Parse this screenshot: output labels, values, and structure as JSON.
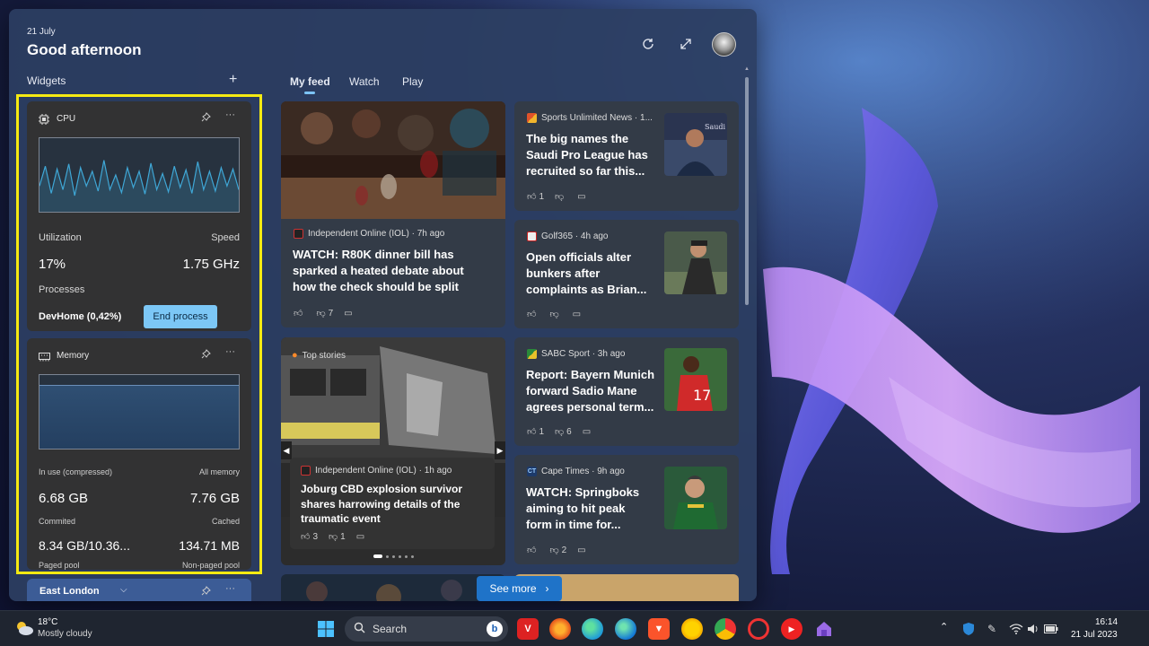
{
  "header": {
    "date": "21 July",
    "greeting": "Good afternoon",
    "icons": [
      "refresh-icon",
      "expand-icon"
    ]
  },
  "widgets": {
    "label": "Widgets",
    "add_symbol": "+",
    "cpu": {
      "title": "CPU",
      "utilization_label": "Utilization",
      "speed_label": "Speed",
      "utilization": "17%",
      "speed": "1.75 GHz",
      "processes_label": "Processes",
      "top_process": "DevHome (0,42%)",
      "end_button": "End process",
      "graph_samples": [
        0.35,
        0.62,
        0.25,
        0.58,
        0.3,
        0.65,
        0.22,
        0.6,
        0.35,
        0.55,
        0.28,
        0.7,
        0.3,
        0.5,
        0.26,
        0.6,
        0.33,
        0.55,
        0.24,
        0.66,
        0.3,
        0.52,
        0.27,
        0.62,
        0.33,
        0.57,
        0.25,
        0.68,
        0.3,
        0.55,
        0.28,
        0.6,
        0.35,
        0.58,
        0.3
      ]
    },
    "memory": {
      "title": "Memory",
      "in_use_label": "In use (compressed)",
      "all_label": "All memory",
      "in_use": "6.68 GB",
      "all": "7.76 GB",
      "committed_label": "Commited",
      "cached_label": "Cached",
      "committed": "8.34 GB/10.36...",
      "cached": "134.71 MB",
      "paged_label": "Paged pool",
      "nonpaged_label": "Non-paged pool",
      "usage_fraction": 0.86
    },
    "weather_location": "East London"
  },
  "feed": {
    "tabs": [
      "My feed",
      "Watch",
      "Play"
    ],
    "cards": [
      {
        "source": "Independent Online (IOL) · 7h ago",
        "headline_lines": [
          "WATCH: R80K dinner bill has",
          "sparked a heated debate about",
          "how the check should be split"
        ],
        "likes": "",
        "dislikes": "7"
      },
      {
        "source": "Sports Unlimited News · 1...",
        "headline_lines": [
          "The big names the",
          "Saudi Pro League has",
          "recruited so far this..."
        ],
        "likes": "1",
        "dislikes": ""
      },
      {
        "source": "Golf365 · 4h ago",
        "headline_lines": [
          "Open officials alter",
          "bunkers after",
          "complaints as Brian..."
        ],
        "likes": "",
        "dislikes": ""
      },
      {
        "top_label": "Top stories",
        "source": "Independent Online (IOL) · 1h ago",
        "headline_lines": [
          "Joburg CBD explosion survivor",
          "shares harrowing details of the",
          "traumatic event"
        ],
        "likes": "3",
        "dislikes": "1"
      },
      {
        "source": "SABC Sport · 3h ago",
        "headline_lines": [
          "Report: Bayern Munich",
          "forward Sadio Mane",
          "agrees personal term..."
        ],
        "likes": "1",
        "dislikes": "6"
      },
      {
        "source": "Cape Times · 9h ago",
        "headline_lines": [
          "WATCH: Springboks",
          "aiming to hit peak",
          "form in time for..."
        ],
        "likes": "",
        "dislikes": "2"
      }
    ],
    "see_more": "See more"
  },
  "taskbar": {
    "temperature": "18°C",
    "condition": "Mostly cloudy",
    "search_placeholder": "Search",
    "time": "16:14",
    "date": "21 Jul 2023"
  }
}
